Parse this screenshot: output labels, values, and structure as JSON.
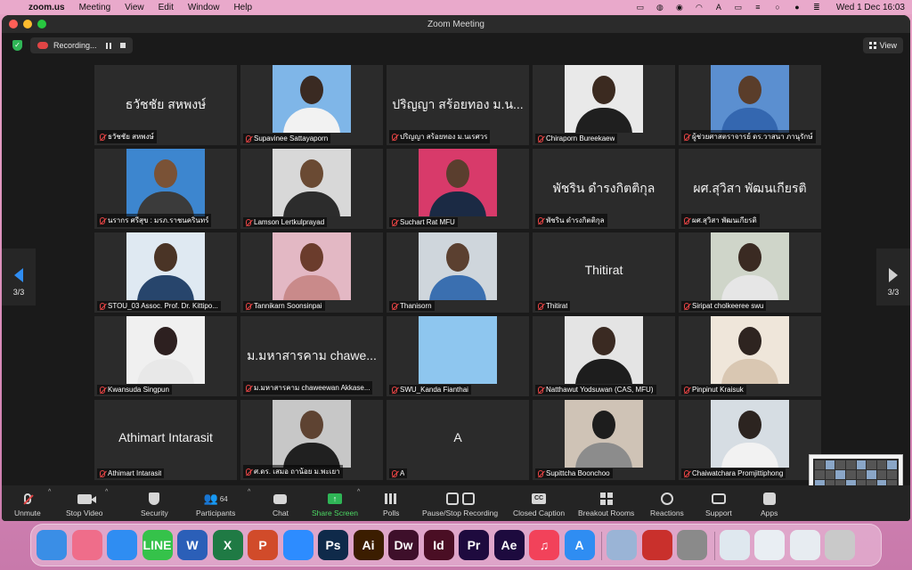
{
  "menubar": {
    "app": "zoom.us",
    "items": [
      "Meeting",
      "View",
      "Edit",
      "Window",
      "Help"
    ],
    "clock": "Wed 1 Dec  16:03"
  },
  "window": {
    "title": "Zoom Meeting",
    "recording_label": "Recording...",
    "view_label": "View"
  },
  "pagination": {
    "left": "3/3",
    "right": "3/3"
  },
  "participants": [
    {
      "name": "ธวัชชัย สหพงษ์",
      "display": "ธวัชชัย สหพงษ์",
      "video": false
    },
    {
      "name": "Supavinee Sattayaporn",
      "video": true,
      "bg": "#7fb6e8",
      "head": "#3a2a22",
      "body": "#f2f2f2"
    },
    {
      "name": "ปริญญา สร้อยทอง ม.นเรศวร",
      "display": "ปริญญา สร้อยทอง ม.น...",
      "video": false
    },
    {
      "name": "Chiraporn Bureekaew",
      "video": true,
      "bg": "#e9e9e9",
      "head": "#3b2a20",
      "body": "#1f1f1f"
    },
    {
      "name": "ผู้ช่วยศาสตราจารย์ ดร.วาสนา ภานุรักษ์",
      "video": true,
      "bg": "#5b8fd0",
      "head": "#5a3d2a",
      "body": "#3467b0"
    },
    {
      "name": "นรากร ศรีสุข : มรภ.ราชนครินทร์",
      "video": true,
      "bg": "#3d86cf",
      "head": "#7a5236",
      "body": "#3b3b3b"
    },
    {
      "name": "Lamson Lertkulprayad",
      "video": true,
      "bg": "#d8d8d8",
      "head": "#6a4a33",
      "body": "#2c2c2c"
    },
    {
      "name": "Suchart Rat MFU",
      "video": true,
      "bg": "#d83a6a",
      "head": "#5a3e2e",
      "body": "#1b2a44"
    },
    {
      "name": "พัชริน ดำรงกิตติกุล",
      "display": "พัชริน ดำรงกิตติกุล",
      "video": false
    },
    {
      "name": "ผศ.สุวิสา พัฒนเกียรติ",
      "display": "ผศ.สุวิสา พัฒนเกียรติ",
      "video": false
    },
    {
      "name": "STOU_03 Assoc. Prof. Dr. Kittipo...",
      "video": true,
      "bg": "#dfe9f2",
      "head": "#4a3426",
      "body": "#27456c"
    },
    {
      "name": "Tannikarn Soonsinpai",
      "video": true,
      "bg": "#e3b8c4",
      "head": "#6b3c2c",
      "body": "#c98a8a"
    },
    {
      "name": "Thanisorn",
      "video": true,
      "bg": "#cfd6dc",
      "head": "#5b4030",
      "body": "#3a6fb0"
    },
    {
      "name": "Thitirat",
      "display": "Thitirat",
      "video": false
    },
    {
      "name": "Siripat cholkeeree swu",
      "video": true,
      "bg": "#cfd5c9",
      "head": "#3a2a22",
      "body": "#e6e6e6"
    },
    {
      "name": "Kwansuda Singpun",
      "video": true,
      "bg": "#f0f0f0",
      "head": "#2d2020",
      "body": "#e8e8e8"
    },
    {
      "name": "ม.มหาสารคาม chaweewan Akkase...",
      "display": "ม.มหาสารคาม chawe...",
      "video": false
    },
    {
      "name": "SWU_Kanda Fianthai",
      "video": true,
      "bg": "#8ec6ef",
      "head": "#8ec6ef",
      "body": "#8ec6ef"
    },
    {
      "name": "Natthawut Yodsuwan (CAS, MFU)",
      "video": true,
      "bg": "#e4e4e4",
      "head": "#3a2a22",
      "body": "#1d1d1d"
    },
    {
      "name": "Pinpinut Kraisuk",
      "video": true,
      "bg": "#efe6da",
      "head": "#2e2420",
      "body": "#d9c7b2"
    },
    {
      "name": "Athimart Intarasit",
      "display": "Athimart Intarasit",
      "video": false
    },
    {
      "name": "ศ.ดร. เสมอ ถาน้อย ม.พะเยา",
      "video": true,
      "bg": "#c7c7c7",
      "head": "#5e4332",
      "body": "#202020"
    },
    {
      "name": "A",
      "display": "A",
      "video": false
    },
    {
      "name": "Supittcha Boonchoo",
      "video": true,
      "bg": "#cfc3b6",
      "head": "#1d1d1d",
      "body": "#8c8c8c"
    },
    {
      "name": "Chaiwatchara Promjittiphong",
      "video": true,
      "bg": "#d6dde3",
      "head": "#2c2420",
      "body": "#f2f2f2"
    }
  ],
  "toolbar": {
    "unmute": "Unmute",
    "stop_video": "Stop Video",
    "security": "Security",
    "participants": "Participants",
    "participants_count": "64",
    "chat": "Chat",
    "share_screen": "Share Screen",
    "polls": "Polls",
    "record": "Pause/Stop Recording",
    "closed_caption": "Closed Caption",
    "breakout_rooms": "Breakout Rooms",
    "reactions": "Reactions",
    "support": "Support",
    "apps": "Apps",
    "cc_glyph": "CC"
  },
  "colors": {
    "share_green": "#2fb556",
    "mute_red": "#e04545",
    "accent_blue": "#2f8df2"
  },
  "dock": [
    {
      "name": "finder",
      "color": "#3a8ee6",
      "glyph": ""
    },
    {
      "name": "launchpad",
      "color": "#ef6d8a",
      "glyph": ""
    },
    {
      "name": "safari",
      "color": "#2f8df2",
      "glyph": ""
    },
    {
      "name": "line",
      "color": "#35c24a",
      "glyph": "LINE"
    },
    {
      "name": "word",
      "color": "#2b5fb8",
      "glyph": "W"
    },
    {
      "name": "excel",
      "color": "#1f7a44",
      "glyph": "X"
    },
    {
      "name": "powerpoint",
      "color": "#d14b2a",
      "glyph": "P"
    },
    {
      "name": "zoom",
      "color": "#2d8cff",
      "glyph": ""
    },
    {
      "name": "photoshop",
      "color": "#0f2a4a",
      "glyph": "Ps"
    },
    {
      "name": "illustrator",
      "color": "#3b1d00",
      "glyph": "Ai"
    },
    {
      "name": "dreamweaver",
      "color": "#3e0f2a",
      "glyph": "Dw"
    },
    {
      "name": "indesign",
      "color": "#4a0e24",
      "glyph": "Id"
    },
    {
      "name": "premiere",
      "color": "#1e0a3e",
      "glyph": "Pr"
    },
    {
      "name": "after-effects",
      "color": "#1d0a3e",
      "glyph": "Ae"
    },
    {
      "name": "music",
      "color": "#f2425a",
      "glyph": "♫"
    },
    {
      "name": "app-store",
      "color": "#2f8df2",
      "glyph": "A"
    },
    {
      "name": "quicktime",
      "color": "#9ab4d6",
      "glyph": ""
    },
    {
      "name": "acrobat",
      "color": "#c9302c",
      "glyph": ""
    },
    {
      "name": "system-preferences",
      "color": "#8a8a8a",
      "glyph": ""
    },
    {
      "name": "document-1",
      "color": "#dfe8ef",
      "glyph": ""
    },
    {
      "name": "document-2",
      "color": "#e9eef3",
      "glyph": ""
    },
    {
      "name": "document-3",
      "color": "#e7ecf1",
      "glyph": ""
    },
    {
      "name": "trash",
      "color": "#c9c9c9",
      "glyph": ""
    }
  ]
}
